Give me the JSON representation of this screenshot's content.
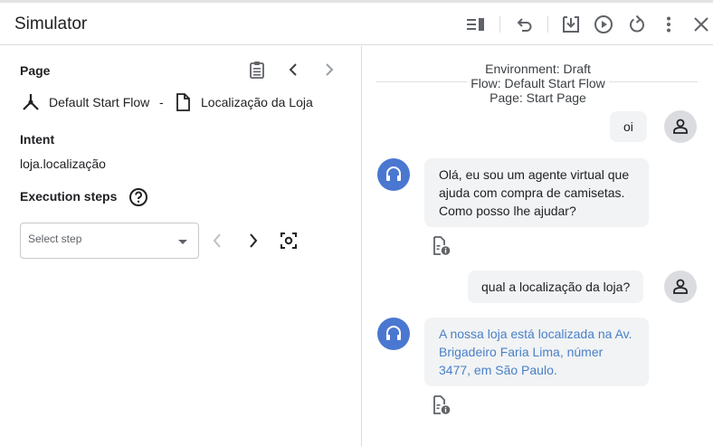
{
  "header": {
    "title": "Simulator",
    "icons": [
      "view-list-icon",
      "undo-icon",
      "download-icon",
      "play-icon",
      "reset-icon",
      "more-vert-icon",
      "close-icon"
    ]
  },
  "left": {
    "page_label": "Page",
    "flow_name": "Default Start Flow",
    "separator": "-",
    "page_name": "Localização da Loja",
    "intent_label": "Intent",
    "intent_value": "loja.localização",
    "execution_label": "Execution steps",
    "select_placeholder": "Select step"
  },
  "right": {
    "environment": "Environment: Draft",
    "flow": "Flow: Default Start Flow",
    "page": "Page: Start Page",
    "messages": [
      {
        "role": "user",
        "text": "oi"
      },
      {
        "role": "agent",
        "text": "Olá, eu sou um agente virtual que ajuda com compra de camisetas. Como posso lhe ajudar?"
      },
      {
        "role": "user",
        "text": "qual a localização da loja?"
      },
      {
        "role": "agent",
        "text": "A nossa loja está localizada na Av. Brigadeiro Faria Lima, númer 3477, em São Paulo."
      }
    ]
  },
  "colors": {
    "agent_avatar": "#4a77d0",
    "bubble": "#f1f3f4",
    "link_text": "#4a80c8",
    "divider": "#dadce0"
  }
}
